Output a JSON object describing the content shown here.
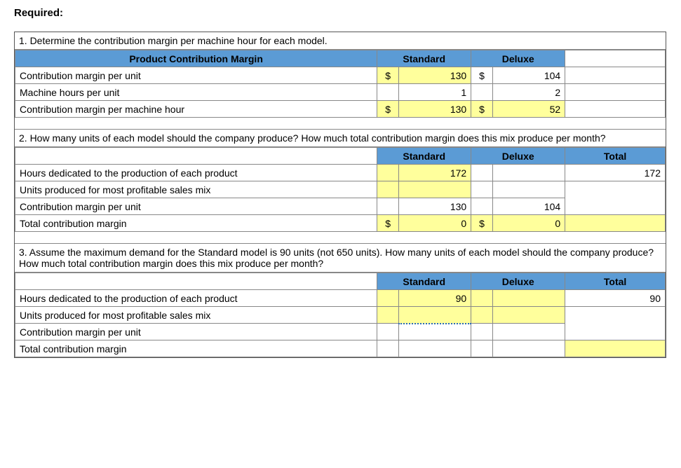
{
  "heading": "Required:",
  "section1": {
    "question": "1. Determine the contribution margin per machine hour for each model.",
    "col_header_main": "Product Contribution Margin",
    "col_header_std": "Standard",
    "col_header_dlx": "Deluxe",
    "rows": [
      {
        "label": "Contribution margin per unit",
        "std_curr": "$",
        "std_val": "130",
        "dlx_curr": "$",
        "dlx_val": "104",
        "std_input": true,
        "dlx_input": false
      },
      {
        "label": "Machine hours per unit",
        "std_curr": "",
        "std_val": "1",
        "dlx_curr": "",
        "dlx_val": "2",
        "std_input": false,
        "dlx_input": false
      },
      {
        "label": "Contribution margin per machine hour",
        "std_curr": "$",
        "std_val": "130",
        "dlx_curr": "$",
        "dlx_val": "52",
        "std_input": true,
        "dlx_input": true
      }
    ]
  },
  "section2": {
    "question": "2. How many units of each model should the company produce? How much total contribution margin does this mix produce per month?",
    "col_header_std": "Standard",
    "col_header_dlx": "Deluxe",
    "col_header_total": "Total",
    "rows": [
      {
        "label": "Hours dedicated to the production of each product",
        "std_curr": "",
        "std_val": "172",
        "dlx_curr": "",
        "dlx_val": "",
        "total": "172",
        "std_input": true,
        "dlx_input": false,
        "total_input": false
      },
      {
        "label": "Units produced for most profitable sales mix",
        "std_curr": "",
        "std_val": "",
        "dlx_curr": "",
        "dlx_val": "",
        "total": "",
        "std_input": true,
        "dlx_input": false,
        "total_input": false,
        "hide_total": true
      },
      {
        "label": "Contribution margin per unit",
        "std_curr": "",
        "std_val": "130",
        "dlx_curr": "",
        "dlx_val": "104",
        "total": "",
        "std_input": false,
        "dlx_input": false,
        "total_input": false,
        "hide_total": true
      },
      {
        "label": "Total contribution margin",
        "std_curr": "$",
        "std_val": "0",
        "dlx_curr": "$",
        "dlx_val": "0",
        "total": "",
        "std_input": true,
        "dlx_input": true,
        "total_input": true
      }
    ]
  },
  "section3": {
    "question": "3. Assume the maximum demand for the Standard model is 90 units (not 650 units). How many units of each model should the company produce? How much total contribution margin does this mix produce per month?",
    "col_header_std": "Standard",
    "col_header_dlx": "Deluxe",
    "col_header_total": "Total",
    "rows": [
      {
        "label": "Hours dedicated to the production of each product",
        "std_curr": "",
        "std_val": "90",
        "dlx_curr": "",
        "dlx_val": "",
        "total": "90",
        "std_input": true,
        "dlx_input": true,
        "total_input": false
      },
      {
        "label": "Units produced for most profitable sales mix",
        "std_curr": "",
        "std_val": "",
        "dlx_curr": "",
        "dlx_val": "",
        "total": "",
        "std_input": true,
        "dlx_input": true,
        "total_input": false,
        "dashed": true,
        "hide_total": true
      },
      {
        "label": "Contribution margin per unit",
        "std_curr": "",
        "std_val": "",
        "dlx_curr": "",
        "dlx_val": "",
        "total": "",
        "std_input": false,
        "dlx_input": false,
        "total_input": false,
        "hide_total": true
      },
      {
        "label": "Total contribution margin",
        "std_curr": "",
        "std_val": "",
        "dlx_curr": "",
        "dlx_val": "",
        "total": "",
        "std_input": false,
        "dlx_input": false,
        "total_input": true
      }
    ]
  }
}
